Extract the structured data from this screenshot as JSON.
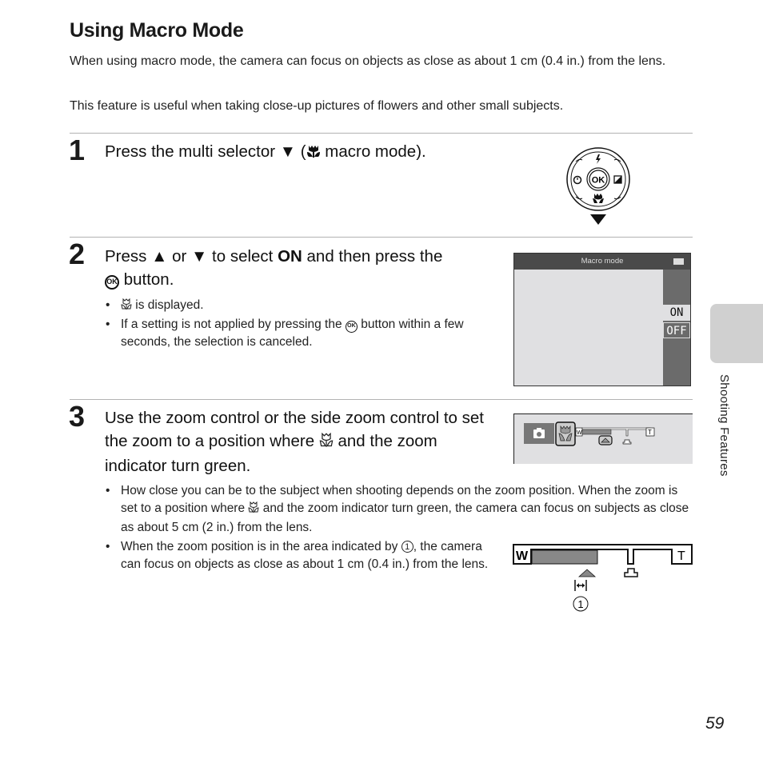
{
  "page": {
    "title": "Using Macro Mode",
    "intro": [
      "When using macro mode, the camera can focus on objects as close as about 1 cm (0.4 in.) from the lens.",
      "This feature is useful when taking close-up pictures of flowers and other small subjects."
    ],
    "section_tab": "Shooting Features",
    "page_number": "59"
  },
  "steps": [
    {
      "number": "1",
      "heading_parts": [
        "Press the multi selector ",
        " (",
        " macro mode)."
      ],
      "icons": [
        "down-triangle",
        "macro-flower"
      ]
    },
    {
      "number": "2",
      "heading_parts": [
        "Press ",
        " or ",
        " to select ",
        "ON",
        " and then press the",
        " button."
      ],
      "bullets": [
        {
          "text": " is displayed."
        },
        {
          "before": "If a setting is not applied by pressing the ",
          "after": " button within a few seconds, the selection is canceled."
        }
      ]
    },
    {
      "number": "3",
      "heading_parts": [
        "Use the zoom control or the side zoom control to set the zoom to a position where ",
        " and the zoom indicator turn green."
      ],
      "bullets": [
        {
          "before": "How close you can be to the subject when shooting depends on the zoom position. When the zoom is set to a position where ",
          "after": " and the zoom indicator turn green, the camera can focus on subjects as close as about 5 cm (2 in.) from the lens."
        },
        {
          "before": "When the zoom position is in the area indicated by ",
          "after": ", the camera can focus on objects as close as about 1 cm (0.4 in.) from the lens."
        }
      ]
    }
  ],
  "multi_selector": {
    "center": "OK",
    "icons": [
      "flash-icon",
      "self-timer-icon",
      "exposure-compensation-icon",
      "macro-icon"
    ]
  },
  "lcd_menu": {
    "title": "Macro mode",
    "options": [
      "ON",
      "OFF"
    ],
    "selected": "OFF"
  },
  "zoom_indicator": {
    "wide_label": "W",
    "tele_label": "T",
    "callout": "1"
  }
}
